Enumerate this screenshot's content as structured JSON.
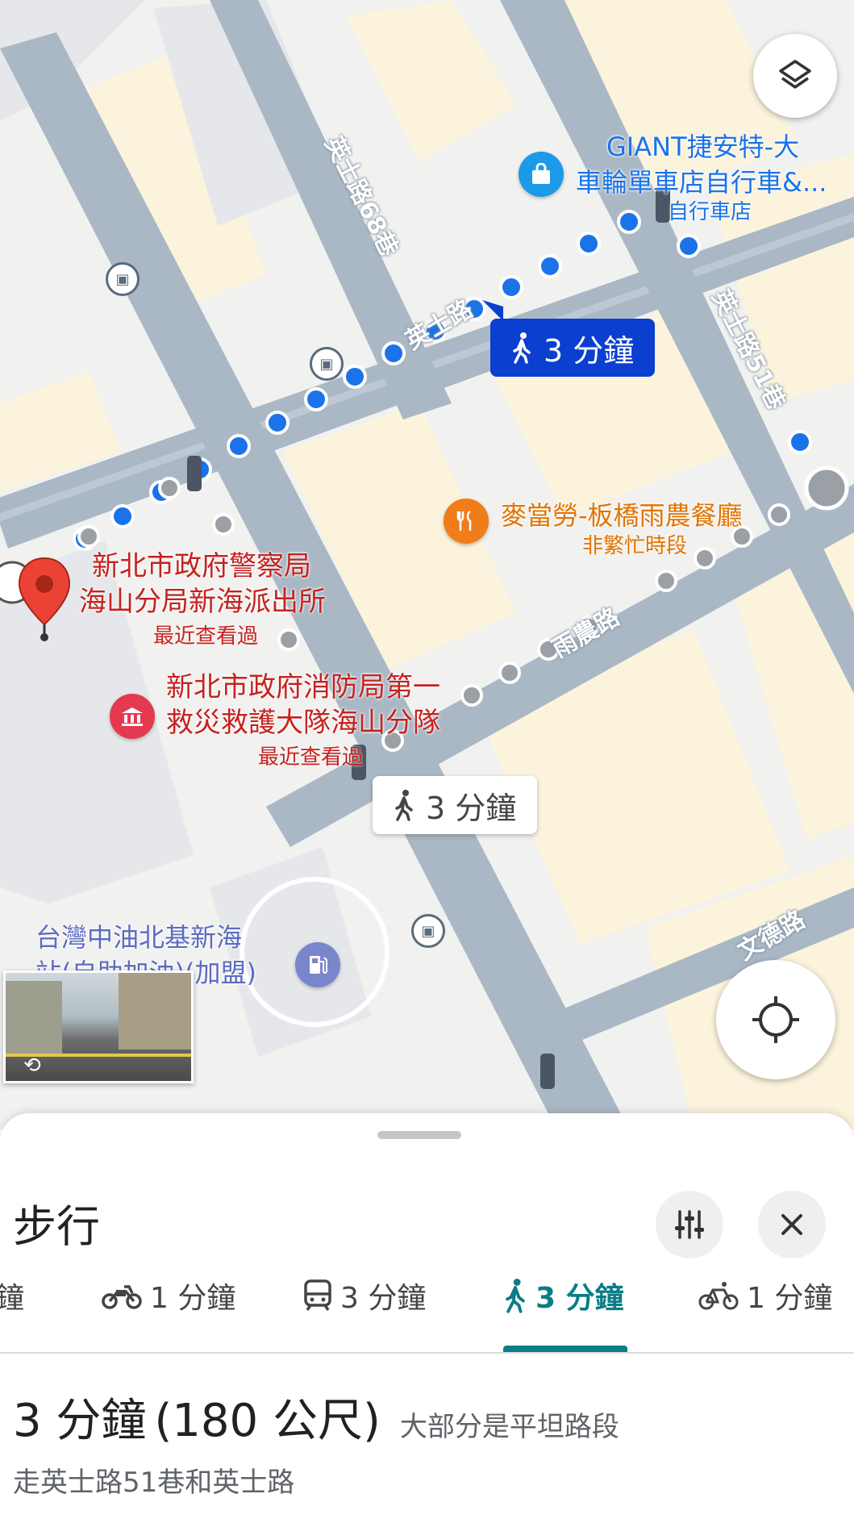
{
  "map": {
    "roads": {
      "yingshi": "英士路",
      "lane68": "英士路68巷",
      "lane51": "英士路51巷",
      "yunong": "雨農路",
      "wende": "文德路"
    },
    "pois": {
      "giant": {
        "name": "GIANT捷安特-大車輪單車店自行車&...",
        "line1": "GIANT捷安特-大",
        "line2": "車輪單車店自行車&...",
        "category": "自行車店",
        "icon": "shopping-bag-icon",
        "color": "#1a9ae8"
      },
      "mcd": {
        "name": "麥當勞-板橋雨農餐廳",
        "status": "非繁忙時段",
        "icon": "fork-knife-icon",
        "color": "#f07c1a"
      },
      "police": {
        "line1": "新北市政府警察局",
        "line2": "海山分局新海派出所",
        "note": "最近查看過",
        "color": "#c5221f"
      },
      "fire": {
        "line1": "新北市政府消防局第一",
        "line2": "救災救護大隊海山分隊",
        "note": "最近查看過",
        "icon": "government-icon",
        "color": "#c5221f"
      },
      "gas": {
        "line1": "台灣中油北基新海",
        "line2": "站(自助加油)(加盟)",
        "icon": "gas-pump-icon",
        "color": "#5c6bc0"
      }
    },
    "route_tag_primary": "3 分鐘",
    "route_tag_alt": "3 分鐘"
  },
  "sheet": {
    "title": "步行",
    "modes": [
      {
        "icon": "car-icon",
        "label": "鐘",
        "selected": false
      },
      {
        "icon": "motorcycle-icon",
        "label": "1 分鐘",
        "selected": false
      },
      {
        "icon": "transit-icon",
        "label": "3 分鐘",
        "selected": false
      },
      {
        "icon": "walking-icon",
        "label": "3 分鐘",
        "selected": true
      },
      {
        "icon": "bicycle-icon",
        "label": "1 分鐘",
        "selected": false
      }
    ],
    "summary": {
      "time": "3 分鐘",
      "distance": "(180 公尺)",
      "terrain": "大部分是平坦路段",
      "via": "走英士路51巷和英士路"
    },
    "accent_color": "#0b57d0",
    "selected_color": "#0a7d86"
  }
}
